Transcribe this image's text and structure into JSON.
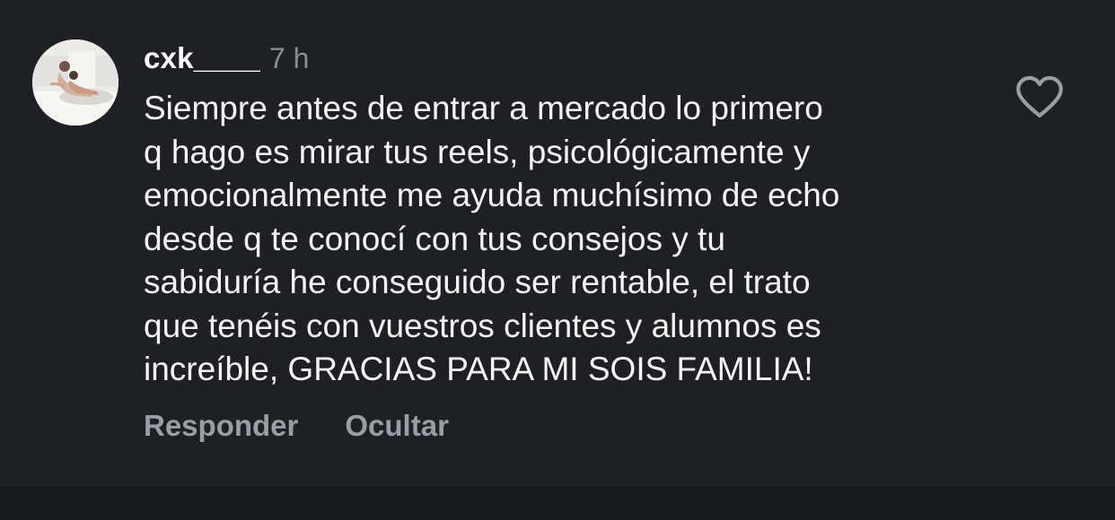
{
  "comment": {
    "username": "cxk____",
    "time": "7 h",
    "lines": [
      "Siempre antes de entrar a mercado lo primero",
      "q hago es mirar tus reels, psicológicamente y",
      "emocionalmente me ayuda muchísimo de echo",
      "desde q te conocí con tus consejos y tu",
      "sabiduría he conseguido ser rentable, el trato",
      "que tenéis con vuestros clientes y alumnos es",
      "increíble, GRACIAS PARA MI SOIS FAMILIA!"
    ],
    "actions": {
      "reply": "Responder",
      "hide": "Ocultar"
    },
    "like_icon": "heart-outline-icon"
  },
  "colors": {
    "background": "#1f2024",
    "text": "#f5f5f5",
    "muted": "#9a9da4"
  }
}
